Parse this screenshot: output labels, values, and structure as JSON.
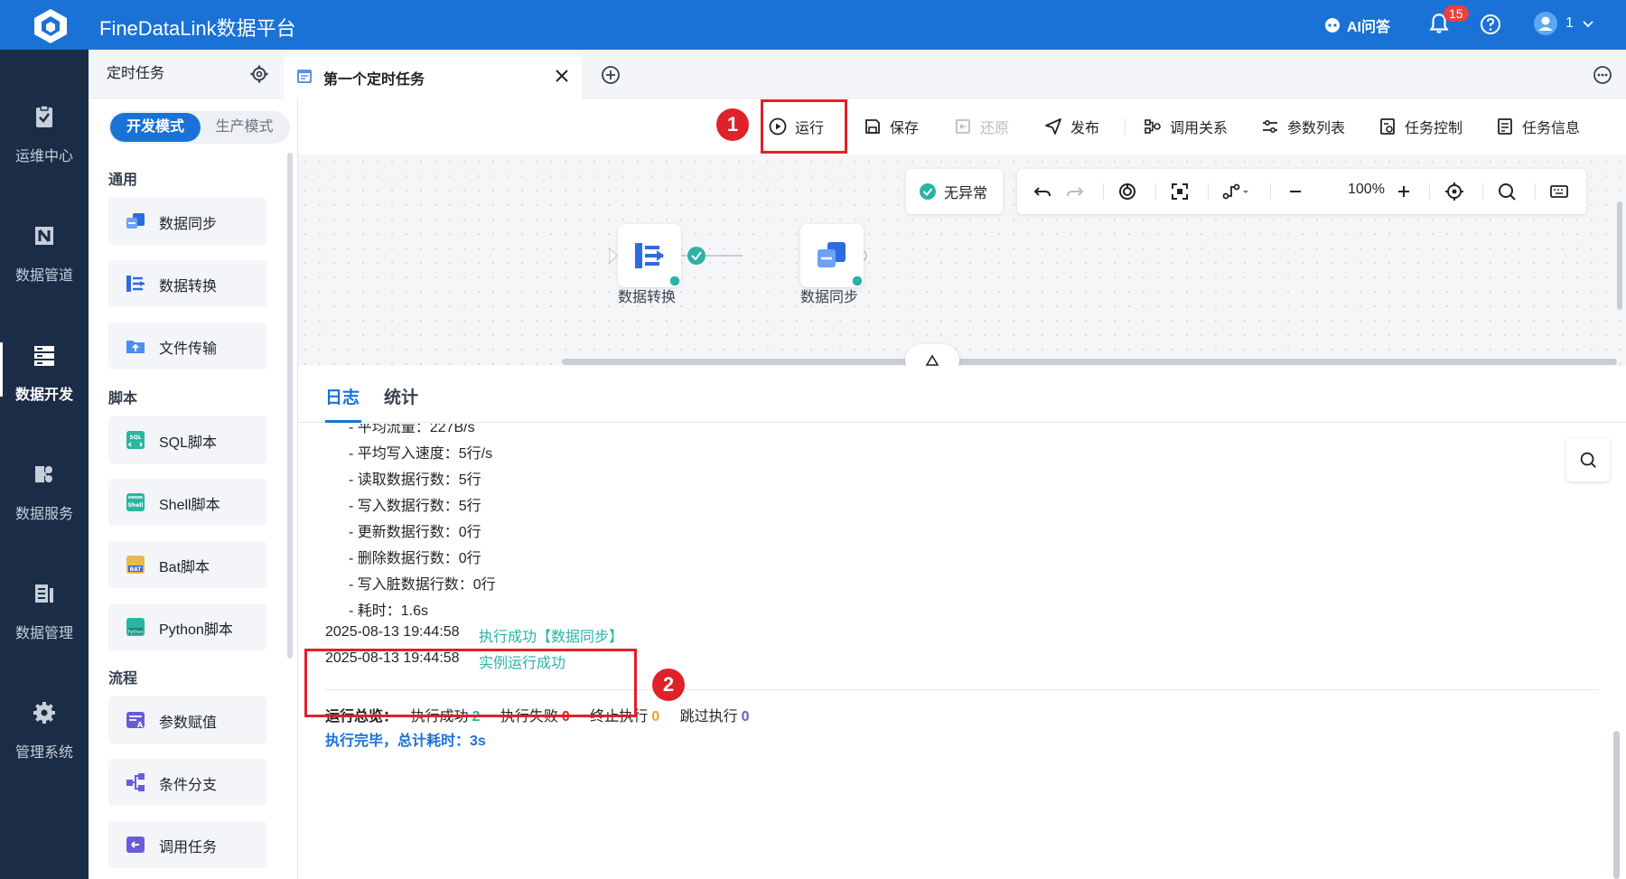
{
  "header": {
    "app_title": "FineDataLink数据平台",
    "ai_label": "AI问答",
    "notification_count": "15",
    "user_label": "1"
  },
  "nav": {
    "items": [
      {
        "label": "运维中心",
        "icon": "clipboard-check-icon"
      },
      {
        "label": "数据管道",
        "icon": "pipeline-icon"
      },
      {
        "label": "数据开发",
        "icon": "dev-stack-icon"
      },
      {
        "label": "数据服务",
        "icon": "service-icon"
      },
      {
        "label": "数据管理",
        "icon": "manage-icon"
      },
      {
        "label": "管理系统",
        "icon": "gear-icon"
      }
    ],
    "active": "数据开发"
  },
  "tabs": {
    "scheduled_label": "定时任务",
    "active_tab_label": "第一个定时任务"
  },
  "panel": {
    "mode_dev": "开发模式",
    "mode_prod": "生产模式",
    "sections": {
      "general": "通用",
      "script": "脚本",
      "flow": "流程"
    },
    "components": {
      "sync": "数据同步",
      "transform": "数据转换",
      "file": "文件传输",
      "sql": "SQL脚本",
      "shell": "Shell脚本",
      "bat": "Bat脚本",
      "python": "Python脚本",
      "param": "参数赋值",
      "branch": "条件分支",
      "invoke": "调用任务"
    }
  },
  "toolbar": {
    "run": "运行",
    "save": "保存",
    "restore": "还原",
    "publish": "发布",
    "call_relation": "调用关系",
    "param_list": "参数列表",
    "task_control": "任务控制",
    "task_info": "任务信息",
    "marker1": "1",
    "marker2": "2"
  },
  "canvas": {
    "status_text": "无异常",
    "zoom": "100%",
    "nodes": [
      {
        "label": "数据转换"
      },
      {
        "label": "数据同步"
      }
    ]
  },
  "log": {
    "tab_log": "日志",
    "tab_stats": "统计",
    "lines": [
      "- 平均流量：227B/s",
      "- 平均写入速度：5行/s",
      "- 读取数据行数：5行",
      "- 写入数据行数：5行",
      "- 更新数据行数：0行",
      "- 删除数据行数：0行",
      "- 写入脏数据行数：0行",
      "- 耗时：1.6s"
    ],
    "results": [
      {
        "time": "2025-08-13 19:44:58",
        "text": "执行成功【数据同步】"
      },
      {
        "time": "2025-08-13 19:44:58",
        "text": "实例运行成功"
      }
    ],
    "summary": {
      "label": "运行总览：",
      "success_label": "执行成功",
      "success": "2",
      "fail_label": "执行失败",
      "fail": "0",
      "stop_label": "终止执行",
      "stop": "0",
      "skip_label": "跳过执行",
      "skip": "0"
    },
    "final_text": "执行完毕，总计耗时：3s"
  },
  "colors": {
    "brand": "#1a72d6",
    "success": "#2ab3a6",
    "fail": "#e0202a",
    "stop": "#f0a020",
    "skip": "#6b5bd6"
  }
}
